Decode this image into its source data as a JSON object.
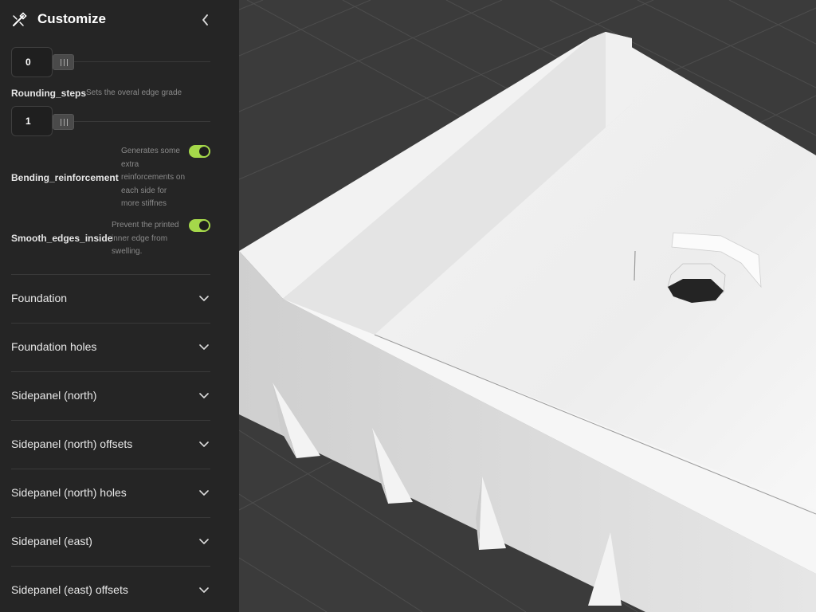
{
  "panel": {
    "title": "Customize",
    "icons": {
      "logo": "magic-wand-icon",
      "collapse": "chevron-left-icon",
      "expand": "chevron-down-icon"
    },
    "sliders": [
      {
        "value": "0"
      },
      {
        "value": "1"
      }
    ],
    "params": {
      "rounding_steps": {
        "label": "Rounding_steps",
        "description": "Sets the overal edge grade"
      },
      "bending_reinforcement": {
        "label": "Bending_reinforcement",
        "description_lines": [
          "Generates some",
          "extra",
          "reinforcements on",
          "each side for",
          "more stiffnes"
        ],
        "enabled": true
      },
      "smooth_edges_inside": {
        "label": "Smooth_edges_inside",
        "description_lines": [
          "Prevent the printed",
          "inner edge from",
          "swelling."
        ],
        "enabled": true
      }
    },
    "sections": [
      {
        "label": "Foundation"
      },
      {
        "label": "Foundation holes"
      },
      {
        "label": "Sidepanel (north)"
      },
      {
        "label": "Sidepanel (north) offsets"
      },
      {
        "label": "Sidepanel (north) holes"
      },
      {
        "label": "Sidepanel (east)"
      },
      {
        "label": "Sidepanel (east) offsets"
      }
    ]
  },
  "colors": {
    "panel_bg": "#252525",
    "viewport_bg": "#3a3a3a",
    "toggle_on": "#a5d84a",
    "model": "#ececec"
  }
}
